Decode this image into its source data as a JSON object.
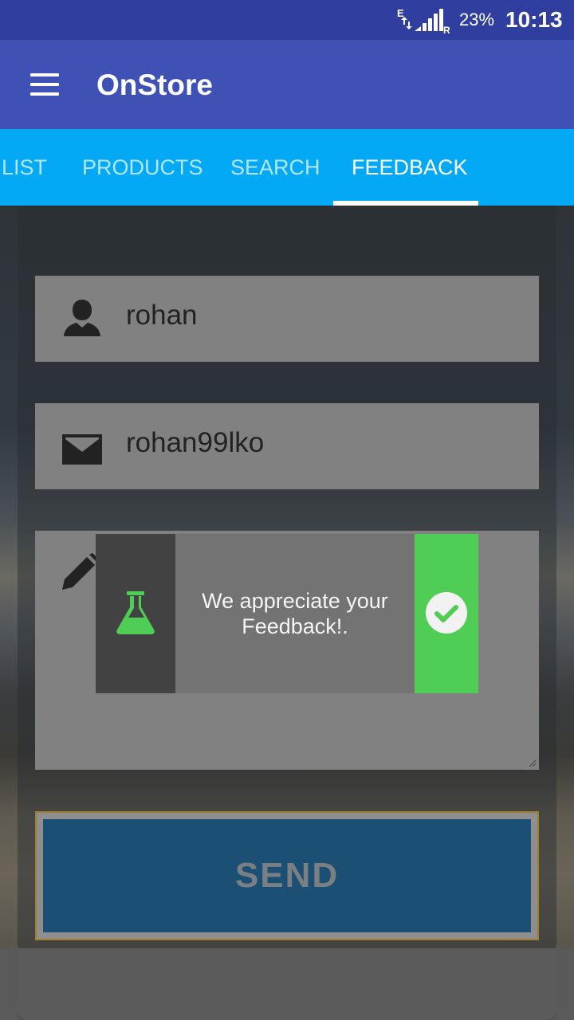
{
  "status_bar": {
    "network_type": "E",
    "roaming": "R",
    "battery": "23%",
    "time": "10:13"
  },
  "app_bar": {
    "title": "OnStore"
  },
  "tabs": [
    {
      "label": "LIST",
      "active": false
    },
    {
      "label": "PRODUCTS",
      "active": false
    },
    {
      "label": "SEARCH",
      "active": false
    },
    {
      "label": "FEEDBACK",
      "active": true
    }
  ],
  "form": {
    "name_value": "rohan",
    "email_value": "rohan99lko",
    "message_value": ""
  },
  "toast": {
    "message": "We appreciate your Feedback!.",
    "accent_color": "#4fcd55"
  },
  "send_button": {
    "label": "SEND"
  },
  "colors": {
    "status_bar": "#303f9f",
    "app_bar": "#3f51b5",
    "tab_bar": "#03a9f4",
    "send_button": "#1b4f73"
  }
}
